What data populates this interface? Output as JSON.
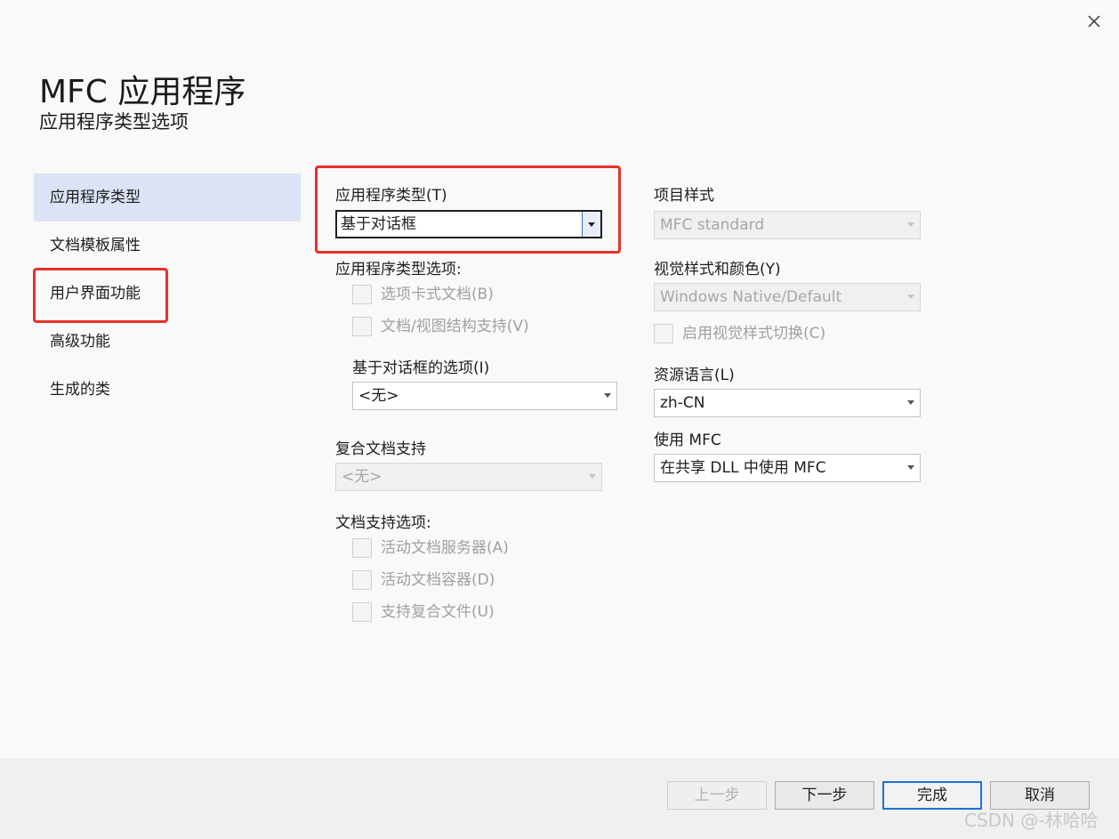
{
  "window": {
    "title": "MFC 应用程序",
    "subtitle": "应用程序类型选项"
  },
  "nav": [
    {
      "label": "应用程序类型",
      "selected": true
    },
    {
      "label": "文档模板属性",
      "selected": false
    },
    {
      "label": "用户界面功能",
      "selected": false
    },
    {
      "label": "高级功能",
      "selected": false
    },
    {
      "label": "生成的类",
      "selected": false
    }
  ],
  "app_type": {
    "label": "应用程序类型(T)",
    "value": "基于对话框"
  },
  "app_type_options": {
    "label": "应用程序类型选项:",
    "tabbed_docs": "选项卡式文档(B)",
    "doc_view": "文档/视图结构支持(V)"
  },
  "dialog_options": {
    "label": "基于对话框的选项(I)",
    "value": "<无>"
  },
  "compound_doc": {
    "label": "复合文档支持",
    "value": "<无>"
  },
  "doc_support": {
    "label": "文档支持选项:",
    "active_server": "活动文档服务器(A)",
    "active_container": "活动文档容器(D)",
    "compound_files": "支持复合文件(U)"
  },
  "project_style": {
    "label": "项目样式",
    "value": "MFC standard"
  },
  "visual_style": {
    "label": "视觉样式和颜色(Y)",
    "value": "Windows Native/Default",
    "toggle": "启用视觉样式切换(C)"
  },
  "resource_lang": {
    "label": "资源语言(L)",
    "value": "zh-CN"
  },
  "use_mfc": {
    "label": "使用 MFC",
    "value": "在共享 DLL 中使用 MFC"
  },
  "footer": {
    "prev": "上一步",
    "next": "下一步",
    "finish": "完成",
    "cancel": "取消"
  },
  "watermark": "CSDN @-林哈哈",
  "colors": {
    "highlight_box": "#e8312a",
    "nav_selected_bg": "#dbe3f5",
    "primary_border": "#1a73d6"
  },
  "icons": {
    "close": "close-icon",
    "dropdown": "chevron-down-icon"
  }
}
